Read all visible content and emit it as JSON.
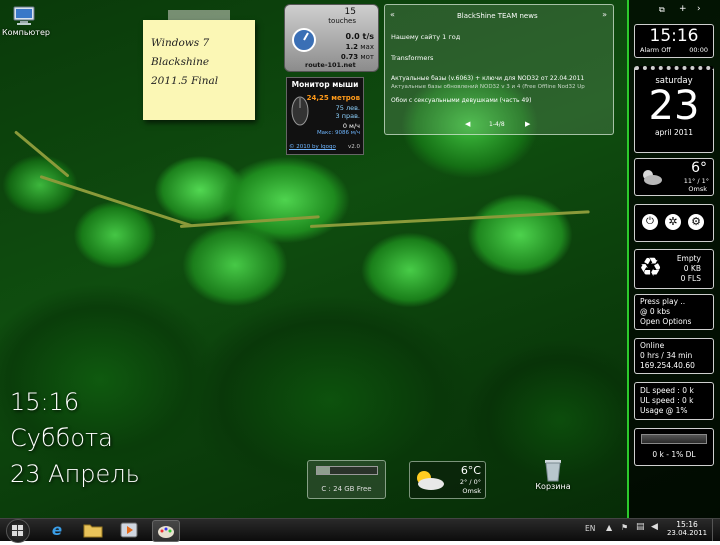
{
  "desktop": {
    "computer_label": "Компьютер",
    "recycle_label": "Корзина"
  },
  "sticky": {
    "lines": [
      "Windows 7",
      "Blackshine",
      "2011.5 Final"
    ]
  },
  "touches": {
    "count": "15",
    "label": "touches",
    "rate": "0.0 t/s",
    "max": "1.2",
    "max_unit": "мах",
    "mov": "0.73",
    "mov_unit": "мот",
    "site": "route-101.net"
  },
  "mouse_monitor": {
    "title": "Монитор мыши",
    "distance": "24,25 метров",
    "left_clicks": "75 лев.",
    "right_clicks": "3 прав.",
    "speed": "0 м/ч",
    "max_speed": "Макс: 9086 м/ч",
    "copyright": "© 2010 by Iqoqo",
    "version": "v2.0"
  },
  "news": {
    "title": "BlackShine TEAM news",
    "items": [
      "Нашему сайту 1 год",
      "Transformers",
      "Актуальные базы (v.6063) + ключи для NOD32 от 22.04.2011",
      "Актуальные базы обновлений NOD32 v 3 и 4 (Free Offline Nod32 Up",
      "Обои с сексуальными девушками (часть 49)"
    ],
    "page": "1-4/8",
    "prev_label": "◀",
    "next_label": "▶",
    "left_arrow": "«",
    "right_arrow": "»"
  },
  "sidebar": {
    "clock_time": "15:16",
    "clock_alarm": "Alarm Off",
    "clock_alarm_time": "00:00",
    "weekday": "saturday",
    "day": "23",
    "month_year": "april 2011",
    "weather_temp": "6°",
    "weather_range": "11° / 1°",
    "weather_city": "Omsk",
    "recycle_status": "Empty",
    "recycle_kb": "0 KB",
    "recycle_fls": "0 FLS",
    "player_line1": "Press play ..",
    "player_line2": "@ 0 kbs",
    "player_line3": "Open Options",
    "net_status": "Online",
    "net_time": "0 hrs / 34 min",
    "net_ip": "169.254.40.60",
    "dl_speed": "DL speed : 0 k",
    "ul_speed": "UL speed : 0 k",
    "usage": "Usage @ 1%",
    "bottom_status": "0 k - 1% DL"
  },
  "big_clock": {
    "time": "15:16",
    "day": "Суббота",
    "date": "23 Апрель"
  },
  "drive": {
    "label": "C : 24 GB Free",
    "usage_fraction": 0.22
  },
  "weather_gadget": {
    "temp": "6°C",
    "range": "2° / 0°",
    "city": "Omsk"
  },
  "taskbar": {
    "lang": "EN",
    "time": "15:16",
    "date": "23.04.2011"
  }
}
